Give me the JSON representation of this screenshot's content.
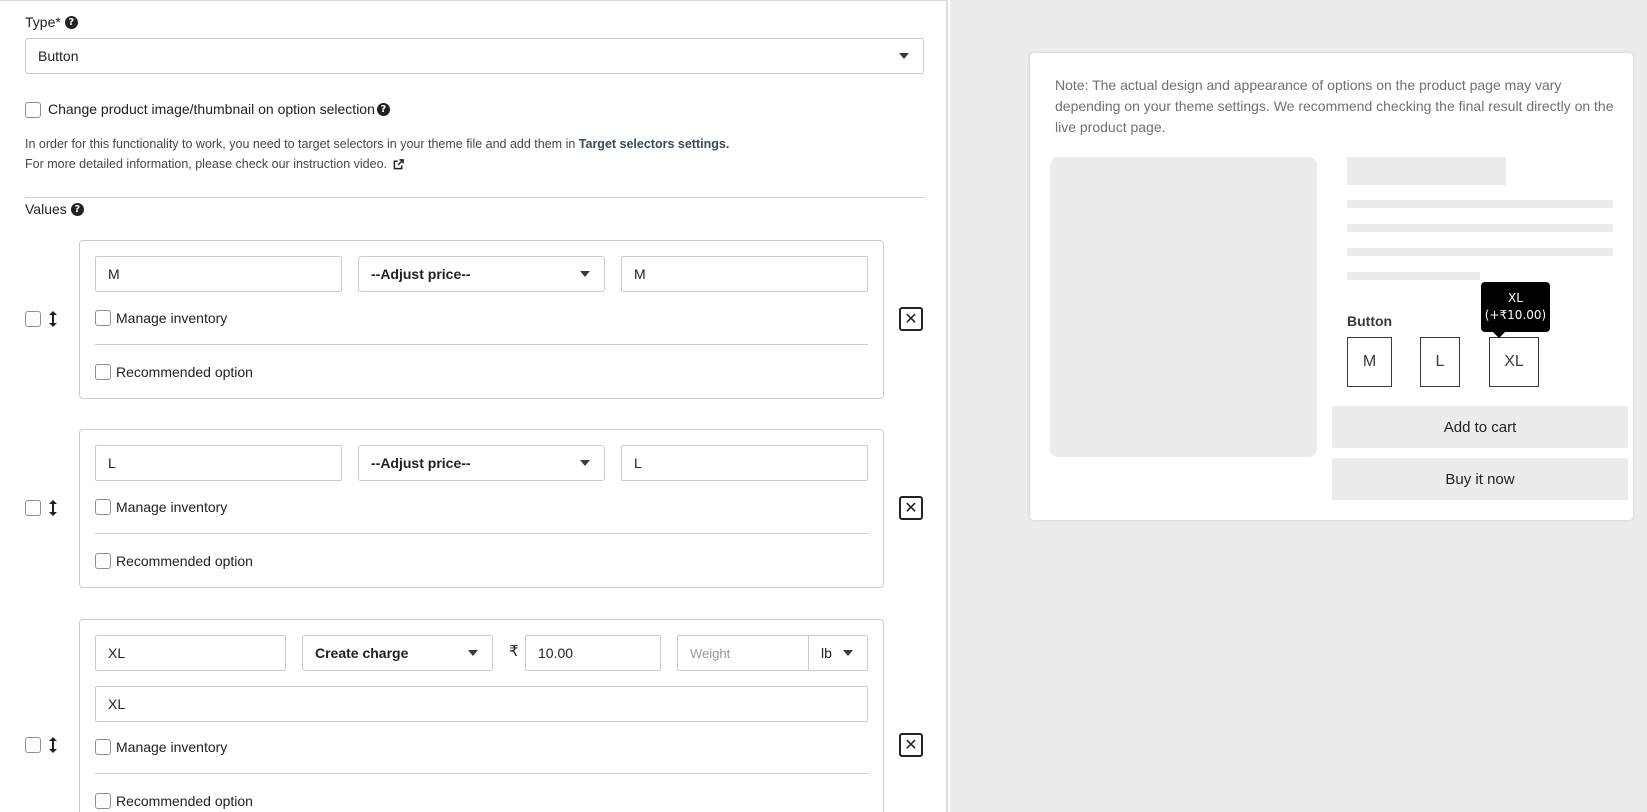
{
  "type_field": {
    "label": "Type*",
    "selected": "Button"
  },
  "change_image": {
    "label": "Change product image/thumbnail on option selection",
    "help_line1": "In order for this functionality to work, you need to target selectors in your theme file and add them in ",
    "help_link": "Target selectors settings.",
    "help_line2": "For more detailed information, please check our instruction video."
  },
  "values_section": {
    "label": "Values",
    "manage_inventory_label": "Manage inventory",
    "recommended_label": "Recommended option",
    "rows": [
      {
        "value": "M",
        "price_select": "--Adjust price--",
        "display": "M"
      },
      {
        "value": "L",
        "price_select": "--Adjust price--",
        "display": "L"
      },
      {
        "value": "XL",
        "price_select": "Create charge",
        "currency": "₹",
        "amount": "10.00",
        "weight_placeholder": "Weight",
        "weight_unit": "lb",
        "display": "XL"
      }
    ]
  },
  "preview": {
    "note": "Note: The actual design and appearance of options on the product page may vary depending on your theme settings. We recommend checking the final result directly on the live product page.",
    "option_label": "Button",
    "options": [
      "M",
      "L",
      "XL"
    ],
    "tooltip_line1": "XL",
    "tooltip_line2": "(+₹10.00)",
    "add_to_cart": "Add to cart",
    "buy_now": "Buy it now"
  },
  "icons": {
    "help": "question-circle-icon",
    "drag": "vertical-arrows-icon",
    "remove": "close-icon",
    "external": "external-link-icon"
  }
}
